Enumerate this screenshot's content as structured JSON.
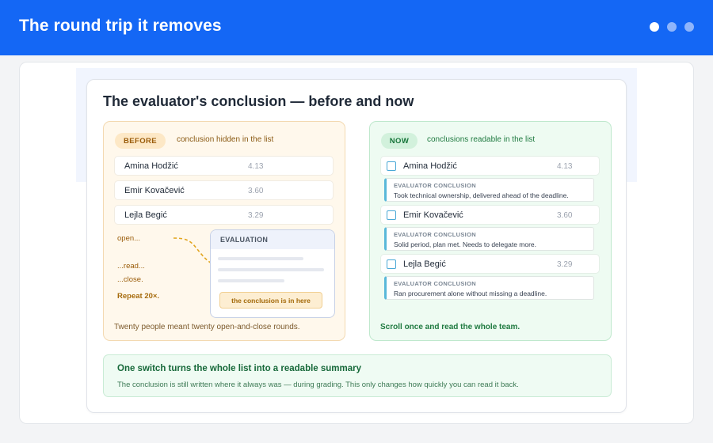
{
  "header": {
    "title": "The round trip it removes",
    "pager": {
      "count": 3,
      "active_index": 0
    },
    "colors": {
      "bar": "#1467f5"
    }
  },
  "slide": {
    "title": "The evaluator's conclusion — before and now",
    "before": {
      "badge": "BEFORE",
      "caption": "conclusion hidden in the list",
      "rows": [
        {
          "name": "Amina Hodžić",
          "score": "4.13"
        },
        {
          "name": "Emir Kovačević",
          "score": "3.60"
        },
        {
          "name": "Lejla Begić",
          "score": "3.29"
        }
      ],
      "steps": {
        "open": "open...",
        "read": "...read...",
        "close": "...close.",
        "repeat": "Repeat 20×."
      },
      "evaluation_window": {
        "title": "EVALUATION",
        "highlight": "the conclusion is in here"
      },
      "footer": "Twenty people meant twenty open-and-close rounds."
    },
    "now": {
      "badge": "NOW",
      "caption": "conclusions readable in the list",
      "rows": [
        {
          "name": "Amina Hodžić",
          "score": "4.13",
          "conclusion_label": "EVALUATOR CONCLUSION",
          "conclusion": "Took technical ownership, delivered ahead of the deadline."
        },
        {
          "name": "Emir Kovačević",
          "score": "3.60",
          "conclusion_label": "EVALUATOR CONCLUSION",
          "conclusion": "Solid period, plan met. Needs to delegate more."
        },
        {
          "name": "Lejla Begić",
          "score": "3.29",
          "conclusion_label": "EVALUATOR CONCLUSION",
          "conclusion": "Ran procurement alone without missing a deadline."
        }
      ],
      "footer": "Scroll once and read the whole team."
    },
    "banner": {
      "title": "One switch turns the whole list into a readable summary",
      "subtitle": "The conclusion is still written where it always was — during grading. This only changes how quickly you can read it back."
    }
  }
}
